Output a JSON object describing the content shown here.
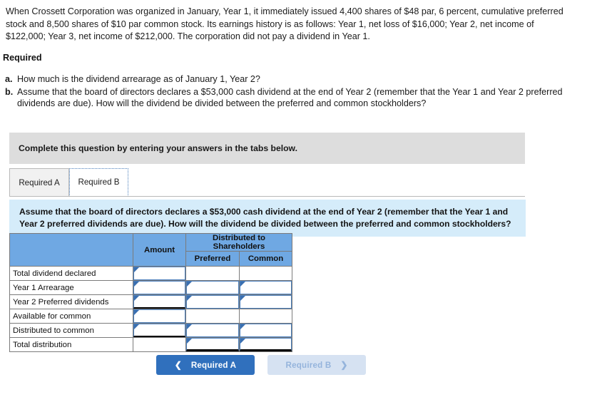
{
  "problem": {
    "text": "When Crossett Corporation was organized in January, Year 1, it immediately issued 4,400 shares of $48 par, 6 percent, cumulative preferred stock and 8,500 shares of $10 par common stock. Its earnings history is as follows: Year 1, net loss of $16,000; Year 2, net income of $122,000; Year 3, net income of $212,000. The corporation did not pay a dividend in Year 1."
  },
  "required": {
    "heading": "Required",
    "items": [
      {
        "marker": "a.",
        "text": "How much is the dividend arrearage as of January 1, Year 2?"
      },
      {
        "marker": "b.",
        "text": "Assume that the board of directors declares a $53,000 cash dividend at the end of Year 2 (remember that the Year 1 and Year 2 preferred dividends are due). How will the dividend be divided between the preferred and common stockholders?"
      }
    ]
  },
  "instruction_banner": {
    "text": "Complete this question by entering your answers in the tabs below."
  },
  "tabs": [
    {
      "label": "Required A",
      "active": false
    },
    {
      "label": "Required B",
      "active": true
    }
  ],
  "info_bar": {
    "text": "Assume that the board of directors declares a $53,000 cash dividend at the end of Year 2 (remember that the Year 1 and Year 2 preferred dividends are due). How will the dividend be divided between the preferred and common stockholders?"
  },
  "table": {
    "group_header": "Distributed to Shareholders",
    "corner_header": "",
    "columns": [
      "Amount",
      "Preferred",
      "Common"
    ],
    "rows": [
      {
        "label": "Total dividend declared",
        "amount": "",
        "preferred": "",
        "common": ""
      },
      {
        "label": "Year 1 Arrearage",
        "amount": "",
        "preferred": "",
        "common": ""
      },
      {
        "label": "Year 2 Preferred dividends",
        "amount": "",
        "preferred": "",
        "common": ""
      },
      {
        "label": "Available for common",
        "amount": "",
        "preferred": "",
        "common": ""
      },
      {
        "label": "Distributed to common",
        "amount": "",
        "preferred": "",
        "common": ""
      },
      {
        "label": "Total distribution",
        "amount": "",
        "preferred": "",
        "common": ""
      }
    ]
  },
  "nav": {
    "prev_label": "Required A",
    "next_label": "Required B",
    "prev_icon": "chevron-left",
    "next_icon": "chevron-right"
  },
  "colors": {
    "primary_button": "#3070bd",
    "disabled_button": "#d6e2f2",
    "table_header": "#6fa8e3",
    "info_bar": "#d5ecfa",
    "instruction_banner": "#dddddd",
    "input_border": "#4a7fbd"
  }
}
